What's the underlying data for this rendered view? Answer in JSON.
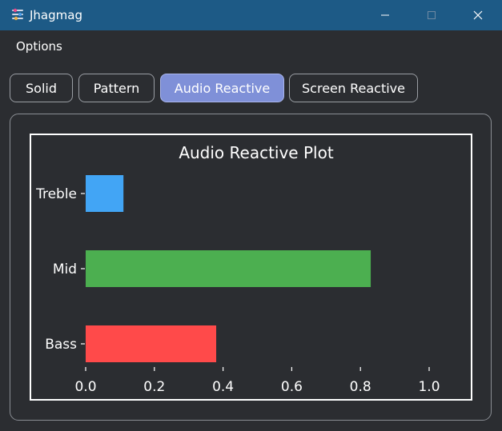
{
  "window": {
    "title": "Jhagmag",
    "app_icon": "sliders-icon",
    "titlebar_color": "#1d5a86",
    "controls": [
      "minimize-icon",
      "maximize-icon",
      "close-icon"
    ]
  },
  "menu": {
    "items": [
      {
        "label": "Options"
      }
    ]
  },
  "tabs": [
    {
      "label": "Solid",
      "active": false
    },
    {
      "label": "Pattern",
      "active": false
    },
    {
      "label": "Audio Reactive",
      "active": true
    },
    {
      "label": "Screen Reactive",
      "active": false
    }
  ],
  "colors": {
    "background": "#2b2d31",
    "active_tab": "#7f90d8",
    "text": "#ffffff"
  },
  "chart_data": {
    "type": "bar",
    "orientation": "horizontal",
    "title": "Audio Reactive Plot",
    "xlabel": "",
    "ylabel": "",
    "categories": [
      "Treble",
      "Mid",
      "Bass"
    ],
    "values": [
      0.11,
      0.83,
      0.38
    ],
    "colors": [
      "#42a5f5",
      "#4caf50",
      "#ff4a4a"
    ],
    "xlim": [
      0.0,
      1.0
    ],
    "xticks": [
      "0.0",
      "0.2",
      "0.4",
      "0.6",
      "0.8",
      "1.0"
    ],
    "grid": false,
    "legend": "none"
  }
}
